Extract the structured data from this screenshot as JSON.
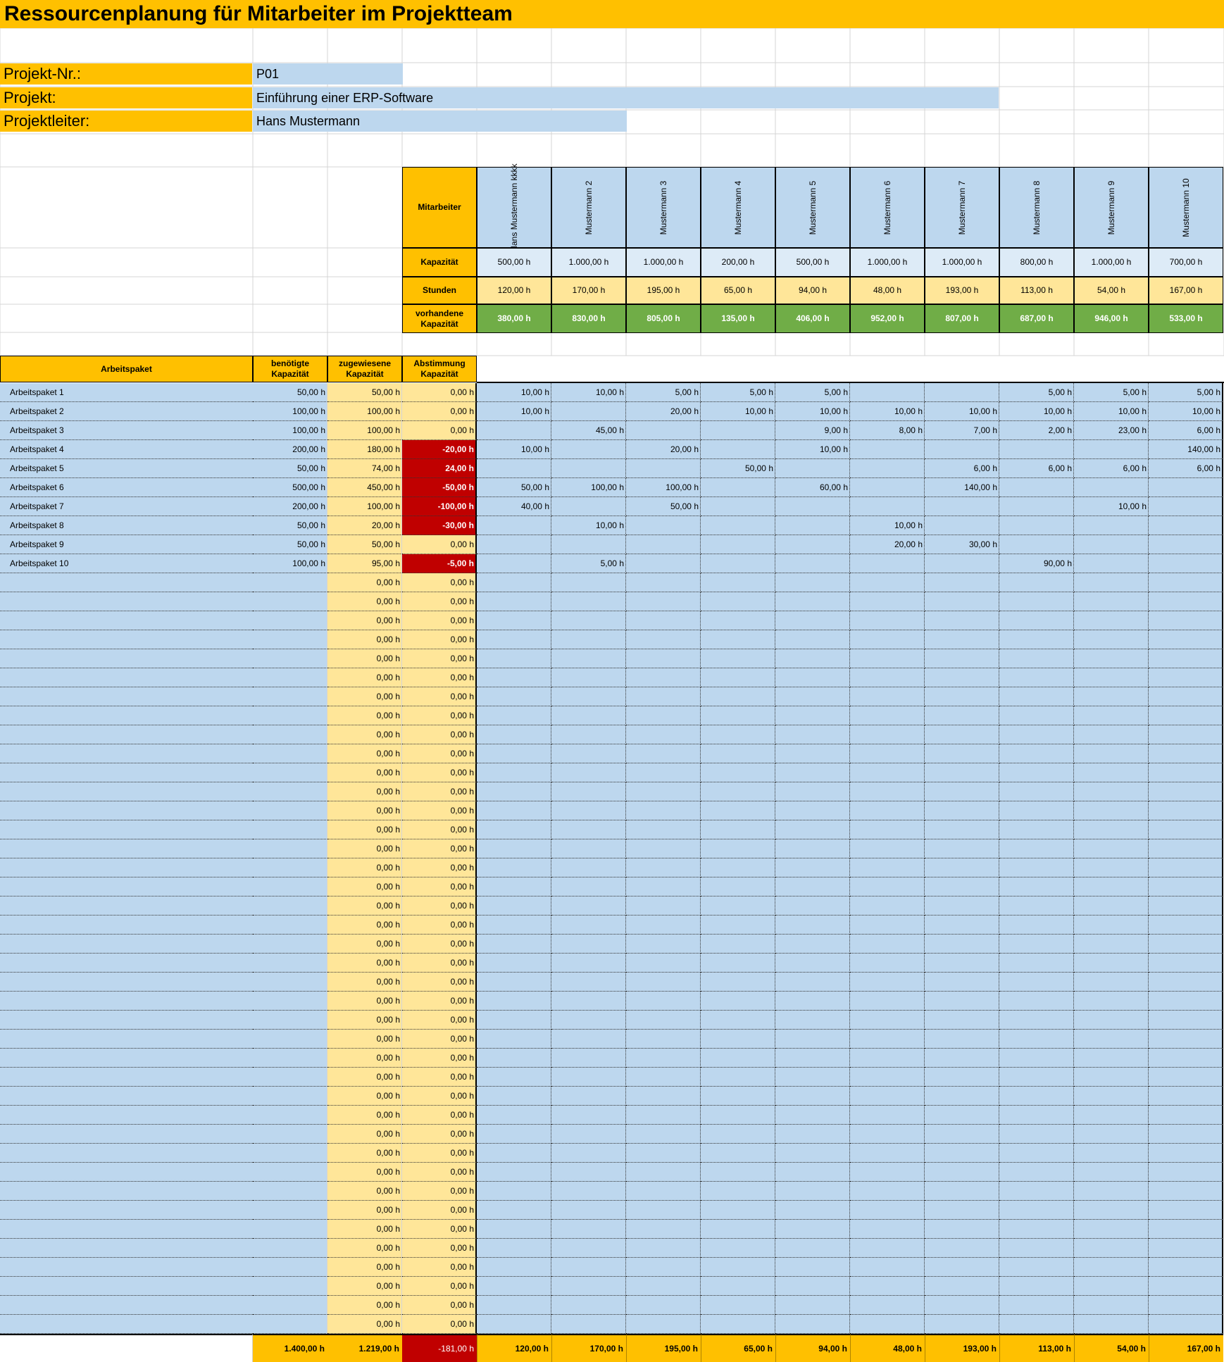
{
  "title": "Ressourcenplanung für Mitarbeiter im Projektteam",
  "project": {
    "nr_label": "Projekt-Nr.:",
    "nr_value": "P01",
    "name_label": "Projekt:",
    "name_value": "Einführung einer ERP-Software",
    "lead_label": "Projektleiter:",
    "lead_value": "Hans Mustermann"
  },
  "summary": {
    "label_employee": "Mitarbeiter",
    "label_capacity": "Kapazität",
    "label_hours": "Stunden",
    "label_available": "vorhandene Kapazität",
    "employees": [
      "Hans Mustermann kkkk",
      "Mustermann 2",
      "Mustermann 3",
      "Mustermann 4",
      "Mustermann 5",
      "Mustermann 6",
      "Mustermann 7",
      "Mustermann 8",
      "Mustermann 9",
      "Mustermann 10"
    ],
    "capacity": [
      "500,00 h",
      "1.000,00 h",
      "1.000,00 h",
      "200,00 h",
      "500,00 h",
      "1.000,00 h",
      "1.000,00 h",
      "800,00 h",
      "1.000,00 h",
      "700,00 h"
    ],
    "hours": [
      "120,00 h",
      "170,00 h",
      "195,00 h",
      "65,00 h",
      "94,00 h",
      "48,00 h",
      "193,00 h",
      "113,00 h",
      "54,00 h",
      "167,00 h"
    ],
    "available": [
      "380,00 h",
      "830,00 h",
      "805,00 h",
      "135,00 h",
      "406,00 h",
      "952,00 h",
      "807,00 h",
      "687,00 h",
      "946,00 h",
      "533,00 h"
    ]
  },
  "table": {
    "headers": {
      "package": "Arbeitspaket",
      "required": "benötigte Kapazität",
      "assigned": "zugewiesene Kapazität",
      "reconciliation": "Abstimmung Kapazität"
    },
    "rows": [
      {
        "name": "Arbeitspaket 1",
        "required": "50,00 h",
        "assigned": "50,00 h",
        "diff": "0,00 h",
        "alert": false,
        "hours": [
          "10,00 h",
          "10,00 h",
          "5,00 h",
          "5,00 h",
          "5,00 h",
          "",
          "",
          "5,00 h",
          "5,00 h",
          "5,00 h"
        ]
      },
      {
        "name": "Arbeitspaket 2",
        "required": "100,00 h",
        "assigned": "100,00 h",
        "diff": "0,00 h",
        "alert": false,
        "hours": [
          "10,00 h",
          "",
          "20,00 h",
          "10,00 h",
          "10,00 h",
          "10,00 h",
          "10,00 h",
          "10,00 h",
          "10,00 h",
          "10,00 h"
        ]
      },
      {
        "name": "Arbeitspaket 3",
        "required": "100,00 h",
        "assigned": "100,00 h",
        "diff": "0,00 h",
        "alert": false,
        "hours": [
          "",
          "45,00 h",
          "",
          "",
          "9,00 h",
          "8,00 h",
          "7,00 h",
          "2,00 h",
          "23,00 h",
          "6,00 h"
        ]
      },
      {
        "name": "Arbeitspaket 4",
        "required": "200,00 h",
        "assigned": "180,00 h",
        "diff": "-20,00 h",
        "alert": true,
        "hours": [
          "10,00 h",
          "",
          "20,00 h",
          "",
          "10,00 h",
          "",
          "",
          "",
          "",
          "140,00 h"
        ]
      },
      {
        "name": "Arbeitspaket 5",
        "required": "50,00 h",
        "assigned": "74,00 h",
        "diff": "24,00 h",
        "alert": true,
        "hours": [
          "",
          "",
          "",
          "50,00 h",
          "",
          "",
          "6,00 h",
          "6,00 h",
          "6,00 h",
          "6,00 h"
        ]
      },
      {
        "name": "Arbeitspaket 6",
        "required": "500,00 h",
        "assigned": "450,00 h",
        "diff": "-50,00 h",
        "alert": true,
        "hours": [
          "50,00 h",
          "100,00 h",
          "100,00 h",
          "",
          "60,00 h",
          "",
          "140,00 h",
          "",
          "",
          ""
        ]
      },
      {
        "name": "Arbeitspaket 7",
        "required": "200,00 h",
        "assigned": "100,00 h",
        "diff": "-100,00 h",
        "alert": true,
        "hours": [
          "40,00 h",
          "",
          "50,00 h",
          "",
          "",
          "",
          "",
          "",
          "10,00 h",
          ""
        ]
      },
      {
        "name": "Arbeitspaket 8",
        "required": "50,00 h",
        "assigned": "20,00 h",
        "diff": "-30,00 h",
        "alert": true,
        "hours": [
          "",
          "10,00 h",
          "",
          "",
          "",
          "10,00 h",
          "",
          "",
          "",
          ""
        ]
      },
      {
        "name": "Arbeitspaket 9",
        "required": "50,00 h",
        "assigned": "50,00 h",
        "diff": "0,00 h",
        "alert": false,
        "hours": [
          "",
          "",
          "",
          "",
          "",
          "20,00 h",
          "30,00 h",
          "",
          "",
          ""
        ]
      },
      {
        "name": "Arbeitspaket 10",
        "required": "100,00 h",
        "assigned": "95,00 h",
        "diff": "-5,00 h",
        "alert": true,
        "hours": [
          "",
          "5,00 h",
          "",
          "",
          "",
          "",
          "",
          "90,00 h",
          "",
          ""
        ]
      },
      {
        "name": "",
        "required": "",
        "assigned": "0,00 h",
        "diff": "0,00 h",
        "alert": false,
        "hours": [
          "",
          "",
          "",
          "",
          "",
          "",
          "",
          "",
          "",
          ""
        ]
      },
      {
        "name": "",
        "required": "",
        "assigned": "0,00 h",
        "diff": "0,00 h",
        "alert": false,
        "hours": [
          "",
          "",
          "",
          "",
          "",
          "",
          "",
          "",
          "",
          ""
        ]
      },
      {
        "name": "",
        "required": "",
        "assigned": "0,00 h",
        "diff": "0,00 h",
        "alert": false,
        "hours": [
          "",
          "",
          "",
          "",
          "",
          "",
          "",
          "",
          "",
          ""
        ]
      },
      {
        "name": "",
        "required": "",
        "assigned": "0,00 h",
        "diff": "0,00 h",
        "alert": false,
        "hours": [
          "",
          "",
          "",
          "",
          "",
          "",
          "",
          "",
          "",
          ""
        ]
      },
      {
        "name": "",
        "required": "",
        "assigned": "0,00 h",
        "diff": "0,00 h",
        "alert": false,
        "hours": [
          "",
          "",
          "",
          "",
          "",
          "",
          "",
          "",
          "",
          ""
        ]
      },
      {
        "name": "",
        "required": "",
        "assigned": "0,00 h",
        "diff": "0,00 h",
        "alert": false,
        "hours": [
          "",
          "",
          "",
          "",
          "",
          "",
          "",
          "",
          "",
          ""
        ]
      },
      {
        "name": "",
        "required": "",
        "assigned": "0,00 h",
        "diff": "0,00 h",
        "alert": false,
        "hours": [
          "",
          "",
          "",
          "",
          "",
          "",
          "",
          "",
          "",
          ""
        ]
      },
      {
        "name": "",
        "required": "",
        "assigned": "0,00 h",
        "diff": "0,00 h",
        "alert": false,
        "hours": [
          "",
          "",
          "",
          "",
          "",
          "",
          "",
          "",
          "",
          ""
        ]
      },
      {
        "name": "",
        "required": "",
        "assigned": "0,00 h",
        "diff": "0,00 h",
        "alert": false,
        "hours": [
          "",
          "",
          "",
          "",
          "",
          "",
          "",
          "",
          "",
          ""
        ]
      },
      {
        "name": "",
        "required": "",
        "assigned": "0,00 h",
        "diff": "0,00 h",
        "alert": false,
        "hours": [
          "",
          "",
          "",
          "",
          "",
          "",
          "",
          "",
          "",
          ""
        ]
      },
      {
        "name": "",
        "required": "",
        "assigned": "0,00 h",
        "diff": "0,00 h",
        "alert": false,
        "hours": [
          "",
          "",
          "",
          "",
          "",
          "",
          "",
          "",
          "",
          ""
        ]
      },
      {
        "name": "",
        "required": "",
        "assigned": "0,00 h",
        "diff": "0,00 h",
        "alert": false,
        "hours": [
          "",
          "",
          "",
          "",
          "",
          "",
          "",
          "",
          "",
          ""
        ]
      },
      {
        "name": "",
        "required": "",
        "assigned": "0,00 h",
        "diff": "0,00 h",
        "alert": false,
        "hours": [
          "",
          "",
          "",
          "",
          "",
          "",
          "",
          "",
          "",
          ""
        ]
      },
      {
        "name": "",
        "required": "",
        "assigned": "0,00 h",
        "diff": "0,00 h",
        "alert": false,
        "hours": [
          "",
          "",
          "",
          "",
          "",
          "",
          "",
          "",
          "",
          ""
        ]
      },
      {
        "name": "",
        "required": "",
        "assigned": "0,00 h",
        "diff": "0,00 h",
        "alert": false,
        "hours": [
          "",
          "",
          "",
          "",
          "",
          "",
          "",
          "",
          "",
          ""
        ]
      },
      {
        "name": "",
        "required": "",
        "assigned": "0,00 h",
        "diff": "0,00 h",
        "alert": false,
        "hours": [
          "",
          "",
          "",
          "",
          "",
          "",
          "",
          "",
          "",
          ""
        ]
      },
      {
        "name": "",
        "required": "",
        "assigned": "0,00 h",
        "diff": "0,00 h",
        "alert": false,
        "hours": [
          "",
          "",
          "",
          "",
          "",
          "",
          "",
          "",
          "",
          ""
        ]
      },
      {
        "name": "",
        "required": "",
        "assigned": "0,00 h",
        "diff": "0,00 h",
        "alert": false,
        "hours": [
          "",
          "",
          "",
          "",
          "",
          "",
          "",
          "",
          "",
          ""
        ]
      },
      {
        "name": "",
        "required": "",
        "assigned": "0,00 h",
        "diff": "0,00 h",
        "alert": false,
        "hours": [
          "",
          "",
          "",
          "",
          "",
          "",
          "",
          "",
          "",
          ""
        ]
      },
      {
        "name": "",
        "required": "",
        "assigned": "0,00 h",
        "diff": "0,00 h",
        "alert": false,
        "hours": [
          "",
          "",
          "",
          "",
          "",
          "",
          "",
          "",
          "",
          ""
        ]
      },
      {
        "name": "",
        "required": "",
        "assigned": "0,00 h",
        "diff": "0,00 h",
        "alert": false,
        "hours": [
          "",
          "",
          "",
          "",
          "",
          "",
          "",
          "",
          "",
          ""
        ]
      },
      {
        "name": "",
        "required": "",
        "assigned": "0,00 h",
        "diff": "0,00 h",
        "alert": false,
        "hours": [
          "",
          "",
          "",
          "",
          "",
          "",
          "",
          "",
          "",
          ""
        ]
      },
      {
        "name": "",
        "required": "",
        "assigned": "0,00 h",
        "diff": "0,00 h",
        "alert": false,
        "hours": [
          "",
          "",
          "",
          "",
          "",
          "",
          "",
          "",
          "",
          ""
        ]
      },
      {
        "name": "",
        "required": "",
        "assigned": "0,00 h",
        "diff": "0,00 h",
        "alert": false,
        "hours": [
          "",
          "",
          "",
          "",
          "",
          "",
          "",
          "",
          "",
          ""
        ]
      },
      {
        "name": "",
        "required": "",
        "assigned": "0,00 h",
        "diff": "0,00 h",
        "alert": false,
        "hours": [
          "",
          "",
          "",
          "",
          "",
          "",
          "",
          "",
          "",
          ""
        ]
      },
      {
        "name": "",
        "required": "",
        "assigned": "0,00 h",
        "diff": "0,00 h",
        "alert": false,
        "hours": [
          "",
          "",
          "",
          "",
          "",
          "",
          "",
          "",
          "",
          ""
        ]
      },
      {
        "name": "",
        "required": "",
        "assigned": "0,00 h",
        "diff": "0,00 h",
        "alert": false,
        "hours": [
          "",
          "",
          "",
          "",
          "",
          "",
          "",
          "",
          "",
          ""
        ]
      },
      {
        "name": "",
        "required": "",
        "assigned": "0,00 h",
        "diff": "0,00 h",
        "alert": false,
        "hours": [
          "",
          "",
          "",
          "",
          "",
          "",
          "",
          "",
          "",
          ""
        ]
      },
      {
        "name": "",
        "required": "",
        "assigned": "0,00 h",
        "diff": "0,00 h",
        "alert": false,
        "hours": [
          "",
          "",
          "",
          "",
          "",
          "",
          "",
          "",
          "",
          ""
        ]
      },
      {
        "name": "",
        "required": "",
        "assigned": "0,00 h",
        "diff": "0,00 h",
        "alert": false,
        "hours": [
          "",
          "",
          "",
          "",
          "",
          "",
          "",
          "",
          "",
          ""
        ]
      },
      {
        "name": "",
        "required": "",
        "assigned": "0,00 h",
        "diff": "0,00 h",
        "alert": false,
        "hours": [
          "",
          "",
          "",
          "",
          "",
          "",
          "",
          "",
          "",
          ""
        ]
      },
      {
        "name": "",
        "required": "",
        "assigned": "0,00 h",
        "diff": "0,00 h",
        "alert": false,
        "hours": [
          "",
          "",
          "",
          "",
          "",
          "",
          "",
          "",
          "",
          ""
        ]
      },
      {
        "name": "",
        "required": "",
        "assigned": "0,00 h",
        "diff": "0,00 h",
        "alert": false,
        "hours": [
          "",
          "",
          "",
          "",
          "",
          "",
          "",
          "",
          "",
          ""
        ]
      },
      {
        "name": "",
        "required": "",
        "assigned": "0,00 h",
        "diff": "0,00 h",
        "alert": false,
        "hours": [
          "",
          "",
          "",
          "",
          "",
          "",
          "",
          "",
          "",
          ""
        ]
      },
      {
        "name": "",
        "required": "",
        "assigned": "0,00 h",
        "diff": "0,00 h",
        "alert": false,
        "hours": [
          "",
          "",
          "",
          "",
          "",
          "",
          "",
          "",
          "",
          ""
        ]
      },
      {
        "name": "",
        "required": "",
        "assigned": "0,00 h",
        "diff": "0,00 h",
        "alert": false,
        "hours": [
          "",
          "",
          "",
          "",
          "",
          "",
          "",
          "",
          "",
          ""
        ]
      },
      {
        "name": "",
        "required": "",
        "assigned": "0,00 h",
        "diff": "0,00 h",
        "alert": false,
        "hours": [
          "",
          "",
          "",
          "",
          "",
          "",
          "",
          "",
          "",
          ""
        ]
      },
      {
        "name": "",
        "required": "",
        "assigned": "0,00 h",
        "diff": "0,00 h",
        "alert": false,
        "hours": [
          "",
          "",
          "",
          "",
          "",
          "",
          "",
          "",
          "",
          ""
        ]
      },
      {
        "name": "",
        "required": "",
        "assigned": "0,00 h",
        "diff": "0,00 h",
        "alert": false,
        "hours": [
          "",
          "",
          "",
          "",
          "",
          "",
          "",
          "",
          "",
          ""
        ]
      },
      {
        "name": "",
        "required": "",
        "assigned": "0,00 h",
        "diff": "0,00 h",
        "alert": false,
        "hours": [
          "",
          "",
          "",
          "",
          "",
          "",
          "",
          "",
          "",
          ""
        ]
      }
    ],
    "totals": {
      "required": "1.400,00 h",
      "assigned": "1.219,00 h",
      "diff": "-181,00 h",
      "hours": [
        "120,00 h",
        "170,00 h",
        "195,00 h",
        "65,00 h",
        "94,00 h",
        "48,00 h",
        "193,00 h",
        "113,00 h",
        "54,00 h",
        "167,00 h"
      ]
    }
  },
  "colors": {
    "header_orange": "#FFC000",
    "input_blue": "#BDD7EE",
    "light_blue": "#DDEBF7",
    "light_yellow": "#FFE699",
    "green": "#70AD47",
    "alert_red": "#C00000"
  }
}
